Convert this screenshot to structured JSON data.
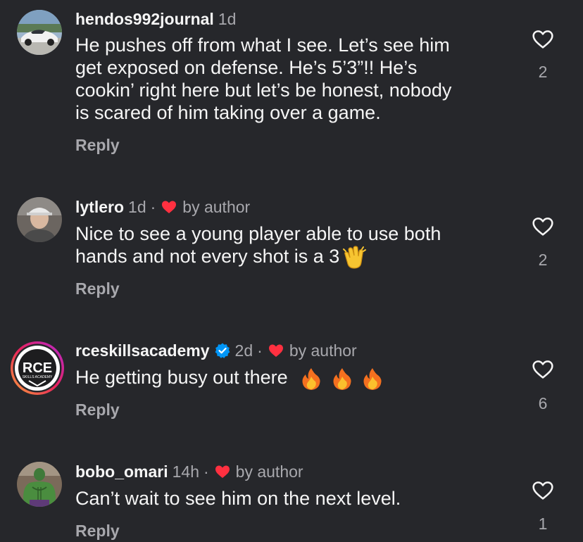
{
  "comments": [
    {
      "username": "hendos992journal",
      "time": "1d",
      "by_author": "",
      "verified": false,
      "lines": [
        "He pushes off from what I see. Let’s see him",
        "get exposed on defense. He’s 5’3”!! He’s",
        "cookin’ right here but let’s be honest, nobody",
        "is scared of him taking over a game."
      ],
      "reply_label": "Reply",
      "like_count": "2"
    },
    {
      "username": "lytlero",
      "time": "1d",
      "by_author": "by author",
      "verified": false,
      "lines": [
        "Nice to see a young player able to use both",
        "hands and not every shot is a 3"
      ],
      "emojis": [
        "clapping-hands"
      ],
      "reply_label": "Reply",
      "like_count": "2"
    },
    {
      "username": "rceskillsacademy",
      "time": "2d",
      "by_author": "by author",
      "verified": true,
      "lines": [
        "He getting busy out there"
      ],
      "emojis": [
        "fire",
        "fire",
        "fire"
      ],
      "reply_label": "Reply",
      "like_count": "6"
    },
    {
      "username": "bobo_omari",
      "time": "14h",
      "by_author": "by author",
      "verified": false,
      "lines": [
        "Can’t wait to see him on the next level."
      ],
      "reply_label": "Reply",
      "like_count": "1"
    }
  ],
  "avatar_logo_text": "RCE",
  "avatar_logo_subtext": "SKILLS ACADEMY",
  "colors": {
    "background": "#26272b",
    "text": "#f5f5f5",
    "muted": "#a8a8ad",
    "heart_red": "#ff3040",
    "verified_blue": "#0095f6"
  }
}
